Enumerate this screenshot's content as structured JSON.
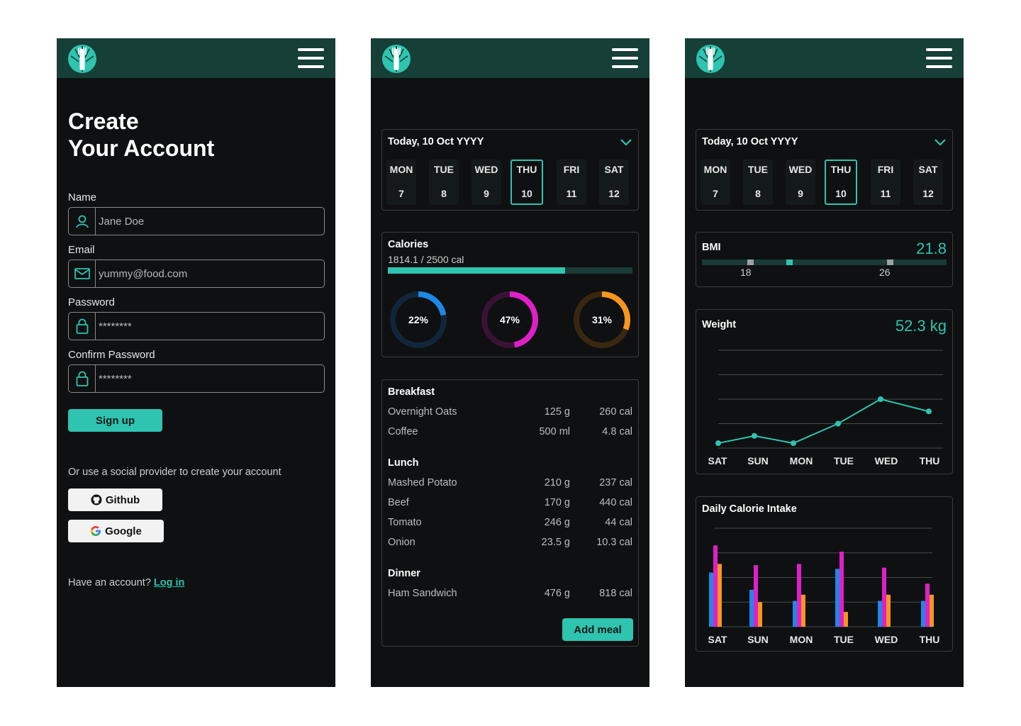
{
  "signup": {
    "title_line1": "Create",
    "title_line2": "Your Account",
    "name_label": "Name",
    "name_value": "Jane Doe",
    "email_label": "Email",
    "email_value": "yummy@food.com",
    "password_label": "Password",
    "password_value": "********",
    "confirm_label": "Confirm Password",
    "confirm_value": "********",
    "signup_button": "Sign up",
    "social_note": "Or use a social provider to create your account",
    "github_button": "Github",
    "google_button": "Google",
    "have_account": "Have an account?",
    "login_link": "Log in"
  },
  "date_picker": {
    "heading": "Today, 10 Oct YYYY",
    "days": [
      {
        "name": "MON",
        "num": "7"
      },
      {
        "name": "TUE",
        "num": "8"
      },
      {
        "name": "WED",
        "num": "9"
      },
      {
        "name": "THU",
        "num": "10",
        "selected": true
      },
      {
        "name": "FRI",
        "num": "11"
      },
      {
        "name": "SAT",
        "num": "12"
      }
    ]
  },
  "calories": {
    "title": "Calories",
    "progress_text": "1814.1 / 2500 cal",
    "progress_fraction": 0.7256,
    "rings": [
      {
        "label": "22%",
        "value": 0.22,
        "color": "#1e88e5",
        "track": "#12263a"
      },
      {
        "label": "47%",
        "value": 0.47,
        "color": "#e01fc9",
        "track": "#3a1236"
      },
      {
        "label": "31%",
        "value": 0.31,
        "color": "#f7961e",
        "track": "#3a2710"
      }
    ]
  },
  "meals": {
    "breakfast": {
      "title": "Breakfast",
      "items": [
        {
          "name": "Overnight Oats",
          "qty": "125 g",
          "cal": "260 cal"
        },
        {
          "name": "Coffee",
          "qty": "500 ml",
          "cal": "4.8 cal"
        }
      ]
    },
    "lunch": {
      "title": "Lunch",
      "items": [
        {
          "name": "Mashed Potato",
          "qty": "210 g",
          "cal": "237 cal"
        },
        {
          "name": "Beef",
          "qty": "170 g",
          "cal": "440 cal"
        },
        {
          "name": "Tomato",
          "qty": "246 g",
          "cal": "44 cal"
        },
        {
          "name": "Onion",
          "qty": "23.5 g",
          "cal": "10.3 cal"
        }
      ]
    },
    "dinner": {
      "title": "Dinner",
      "items": [
        {
          "name": "Ham Sandwich",
          "qty": "476 g",
          "cal": "818 cal"
        }
      ]
    },
    "add_button": "Add meal"
  },
  "bmi": {
    "title": "BMI",
    "value": "21.8",
    "marker_low": "18",
    "marker_high": "26"
  },
  "colors": {
    "accent": "#2ec4b0",
    "header": "#163f37",
    "background": "#0e1011"
  },
  "chart_data": [
    {
      "type": "line",
      "title": "Weight",
      "value_label": "52.3 kg",
      "categories": [
        "SAT",
        "SUN",
        "MON",
        "TUE",
        "WED",
        "THU"
      ],
      "series": [
        {
          "values": [
            0.2,
            0.5,
            0.2,
            1.0,
            2.0,
            1.5
          ]
        }
      ],
      "ylim": [
        0,
        4
      ],
      "grid": true
    },
    {
      "type": "bar",
      "title": "Daily Calorie Intake",
      "categories": [
        "SAT",
        "SUN",
        "MON",
        "TUE",
        "WED",
        "THU"
      ],
      "series": [
        {
          "color": "#1e88e5",
          "values": [
            2.2,
            1.5,
            1.05,
            2.35,
            1.05,
            1.05
          ]
        },
        {
          "color": "#e01fc9",
          "values": [
            3.3,
            2.5,
            2.55,
            3.05,
            2.4,
            1.75
          ]
        },
        {
          "color": "#f7961e",
          "values": [
            2.55,
            1.0,
            1.3,
            0.6,
            1.3,
            1.3
          ]
        }
      ],
      "ylim": [
        0,
        4
      ],
      "grid": true
    }
  ]
}
